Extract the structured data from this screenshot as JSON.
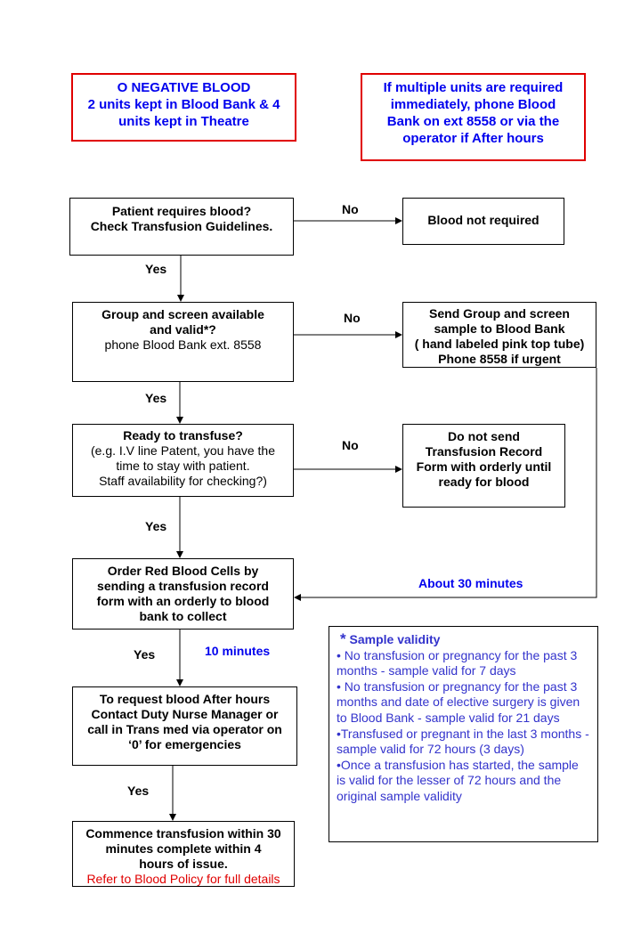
{
  "notices": {
    "o_negative": [
      "O NEGATIVE BLOOD",
      "2 units kept in Blood Bank & 4",
      "units kept in Theatre"
    ],
    "multiple_units": [
      "If multiple units are required",
      "immediately, phone Blood",
      "Bank on ext 8558 or via the",
      "operator if After hours"
    ]
  },
  "steps": {
    "s1": {
      "bold": [
        "Patient requires blood?",
        "Check Transfusion Guidelines."
      ]
    },
    "s1_no": {
      "bold": [
        "Blood not required"
      ]
    },
    "s2": {
      "bold": [
        "Group and screen available",
        "and valid*?"
      ],
      "normal": [
        "phone Blood Bank ext. 8558"
      ]
    },
    "s2_no": {
      "bold": [
        "Send Group and screen",
        "sample to Blood Bank",
        "( hand labeled pink top tube)",
        "Phone 8558 if urgent"
      ]
    },
    "s3": {
      "bold": [
        "Ready to transfuse?"
      ],
      "normal": [
        "(e.g. I.V line Patent, you have the",
        "time to stay with patient.",
        "Staff availability  for checking?)"
      ]
    },
    "s3_no": {
      "bold": [
        "Do not send",
        "Transfusion Record",
        "Form with orderly until",
        "ready for blood"
      ]
    },
    "s4": {
      "bold": [
        "Order Red Blood Cells by",
        "sending a transfusion record",
        "form with an orderly to blood",
        "bank to collect"
      ]
    },
    "s5": {
      "bold": [
        "To request blood After  hours",
        "Contact Duty Nurse Manager or",
        "call in Trans med via operator on",
        "‘0’ for emergencies"
      ]
    },
    "s6": {
      "bold": [
        "Commence transfusion within 30",
        "minutes complete  within 4",
        "hours of issue."
      ],
      "red": "Refer to Blood Policy for full details"
    }
  },
  "labels": {
    "no": "No",
    "yes": "Yes",
    "about_30": "About 30 minutes",
    "ten_min": "10 minutes"
  },
  "validity": {
    "star": "*",
    "title": "Sample validity",
    "items": [
      "• No transfusion or pregnancy for the past 3 months - sample valid for 7 days",
      "• No transfusion or pregnancy for the past 3 months and date of elective surgery is given to Blood Bank - sample valid for 21 days",
      "•Transfused or pregnant in the last 3 months - sample valid for 72 hours (3 days)",
      "•Once a transfusion has started, the sample is valid for the lesser of 72 hours and the original sample validity"
    ]
  },
  "colors": {
    "notice_border": "#e00000",
    "notice_text": "#0000ee",
    "validity_text": "#3333cc"
  }
}
